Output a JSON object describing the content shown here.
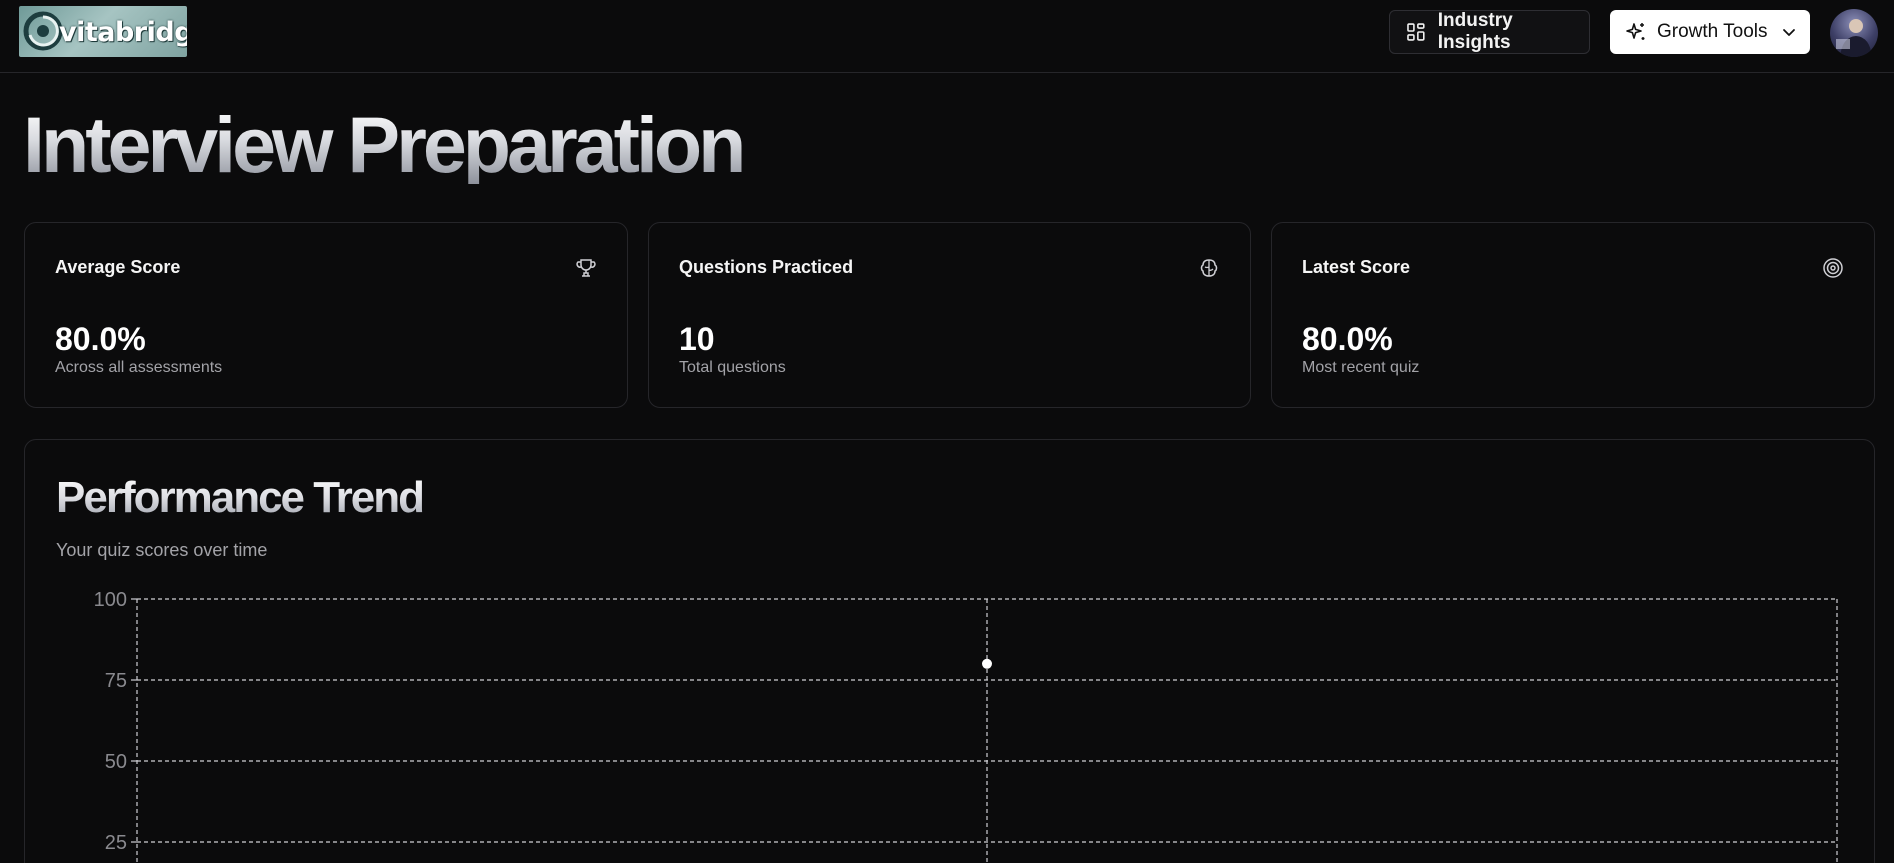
{
  "header": {
    "logo_text": "vitabridge",
    "insights_label": "Industry Insights",
    "growth_label": "Growth Tools",
    "icons": {
      "insights": "dashboard-grid-icon",
      "growth": "sparkles-icon",
      "dropdown": "chevron-down-icon"
    }
  },
  "page": {
    "title": "Interview Preparation"
  },
  "stats": [
    {
      "title": "Average Score",
      "value": "80.0%",
      "sub": "Across all assessments",
      "icon": "trophy-icon"
    },
    {
      "title": "Questions Practiced",
      "value": "10",
      "sub": "Total questions",
      "icon": "brain-icon"
    },
    {
      "title": "Latest Score",
      "value": "80.0%",
      "sub": "Most recent quiz",
      "icon": "target-icon"
    }
  ],
  "trend": {
    "title": "Performance Trend",
    "subtitle": "Your quiz scores over time"
  },
  "chart_data": {
    "type": "scatter",
    "title": "Performance Trend",
    "subtitle": "Your quiz scores over time",
    "xlabel": "",
    "ylabel": "",
    "ylim": [
      0,
      100
    ],
    "yticks_visible": [
      "100",
      "75",
      "50",
      "25"
    ],
    "grid": true,
    "series": [
      {
        "values": [
          80
        ]
      }
    ],
    "point_color": "#ffffff",
    "grid_color": "#cfcfd4"
  },
  "theme": {
    "background": "#0b0b0c",
    "card_border": "#26262a",
    "accent": "#ffffff",
    "muted_text": "#a3a3a8"
  }
}
